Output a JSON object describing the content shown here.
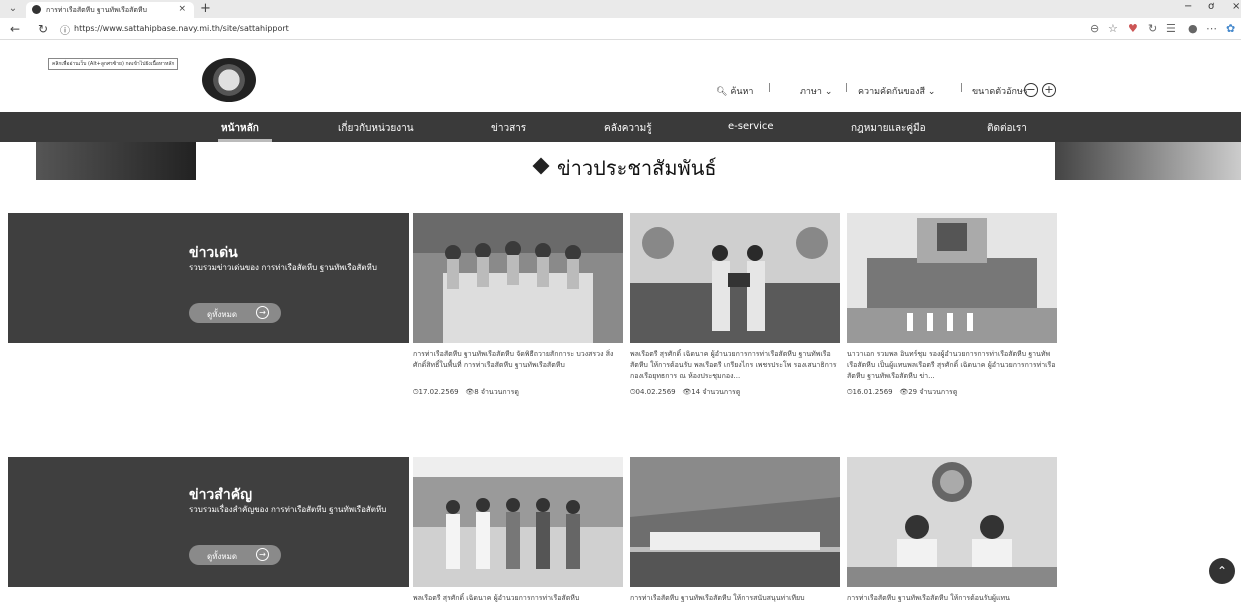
{
  "browser": {
    "tab_title": "การท่าเรือสัตหีบ ฐานทัพเรือสัตหีบ",
    "tab_close": "×",
    "new_tab": "+",
    "url": "https://www.sattahipbase.navy.mi.th/site/sattahipport",
    "win_min": "−",
    "win_max": "ơ",
    "win_close": "×"
  },
  "header": {
    "skip_tip": "คลิกเพื่ออ่านเว็บ (Alt+ลูกศรซ้าย) กดเข้าไปยังเนื้อหาหลัก",
    "search_label": "ค้นหา",
    "language_label": "ภาษา",
    "contrast_label": "ความคัดกันของสี",
    "fontsize_label": "ขนาดตัวอักษร"
  },
  "nav": {
    "items": [
      "หน้าหลัก",
      "เกี่ยวกับหน่วยงาน",
      "ข่าวสาร",
      "คลังความรู้",
      "e-service",
      "กฎหมายและคู่มือ",
      "ติดต่อเรา"
    ]
  },
  "page": {
    "section_title": "ข่าวประชาสัมพันธ์"
  },
  "featured": {
    "title": "ข่าวเด่น",
    "desc": "รวบรวมข่าวเด่นของ การท่าเรือสัตหีบ ฐานทัพเรือสัตหีบ",
    "button": "ดูทั้งหมด",
    "items": [
      {
        "text": "การท่าเรือสัตหีบ ฐานทัพเรือสัตหีบ จัดพิธีถวายสักการะ บวงสรวง สิ่งศักดิ์สิทธิ์ในพื้นที่ การท่าเรือสัตหีบ ฐานทัพเรือสัตหีบ",
        "date": "17.02.2569",
        "views": "8 จำนวนการดู"
      },
      {
        "text": "พลเรือตรี สุรศักดิ์ เฉิดนาค ผู้อำนวยการการท่าเรือสัตหีบ ฐานทัพเรือสัตหีบ ให้การต้อนรับ พลเรือตรี เกรียงไกร เพชรประโพ รองเสนาธิการกองเรือยุทธการ ณ ห้องประชุมกอง...",
        "date": "04.02.2569",
        "views": "14 จำนวนการดู"
      },
      {
        "text": "นาวาเอก รวมพล อินทร์ชุม รองผู้อำนวยการการท่าเรือสัตหีบ ฐานทัพเรือสัตหีบ เป็นผู้แทนพลเรือตรี สุรศักดิ์ เฉิดนาค ผู้อำนวยการการท่าเรือสัตหีบ ฐานทัพเรือสัตหีบ ข่า...",
        "date": "16.01.2569",
        "views": "29 จำนวนการดู"
      }
    ]
  },
  "important": {
    "title": "ข่าวสำคัญ",
    "desc": "รวบรวมเรื่องสำคัญของ การท่าเรือสัตหีบ ฐานทัพเรือสัตหีบ",
    "button": "ดูทั้งหมด",
    "items": [
      {
        "text": "พลเรือตรี สุรศักดิ์ เฉิดนาค ผู้อำนวยการการท่าเรือสัตหีบ"
      },
      {
        "text": "การท่าเรือสัตหีบ ฐานทัพเรือสัตหีบ ให้การสนับสนุนท่าเทียบ"
      },
      {
        "text": "การท่าเรือสัตหีบ ฐานทัพเรือสัตหีบ ให้การต้อนรับผู้แทน"
      }
    ]
  }
}
